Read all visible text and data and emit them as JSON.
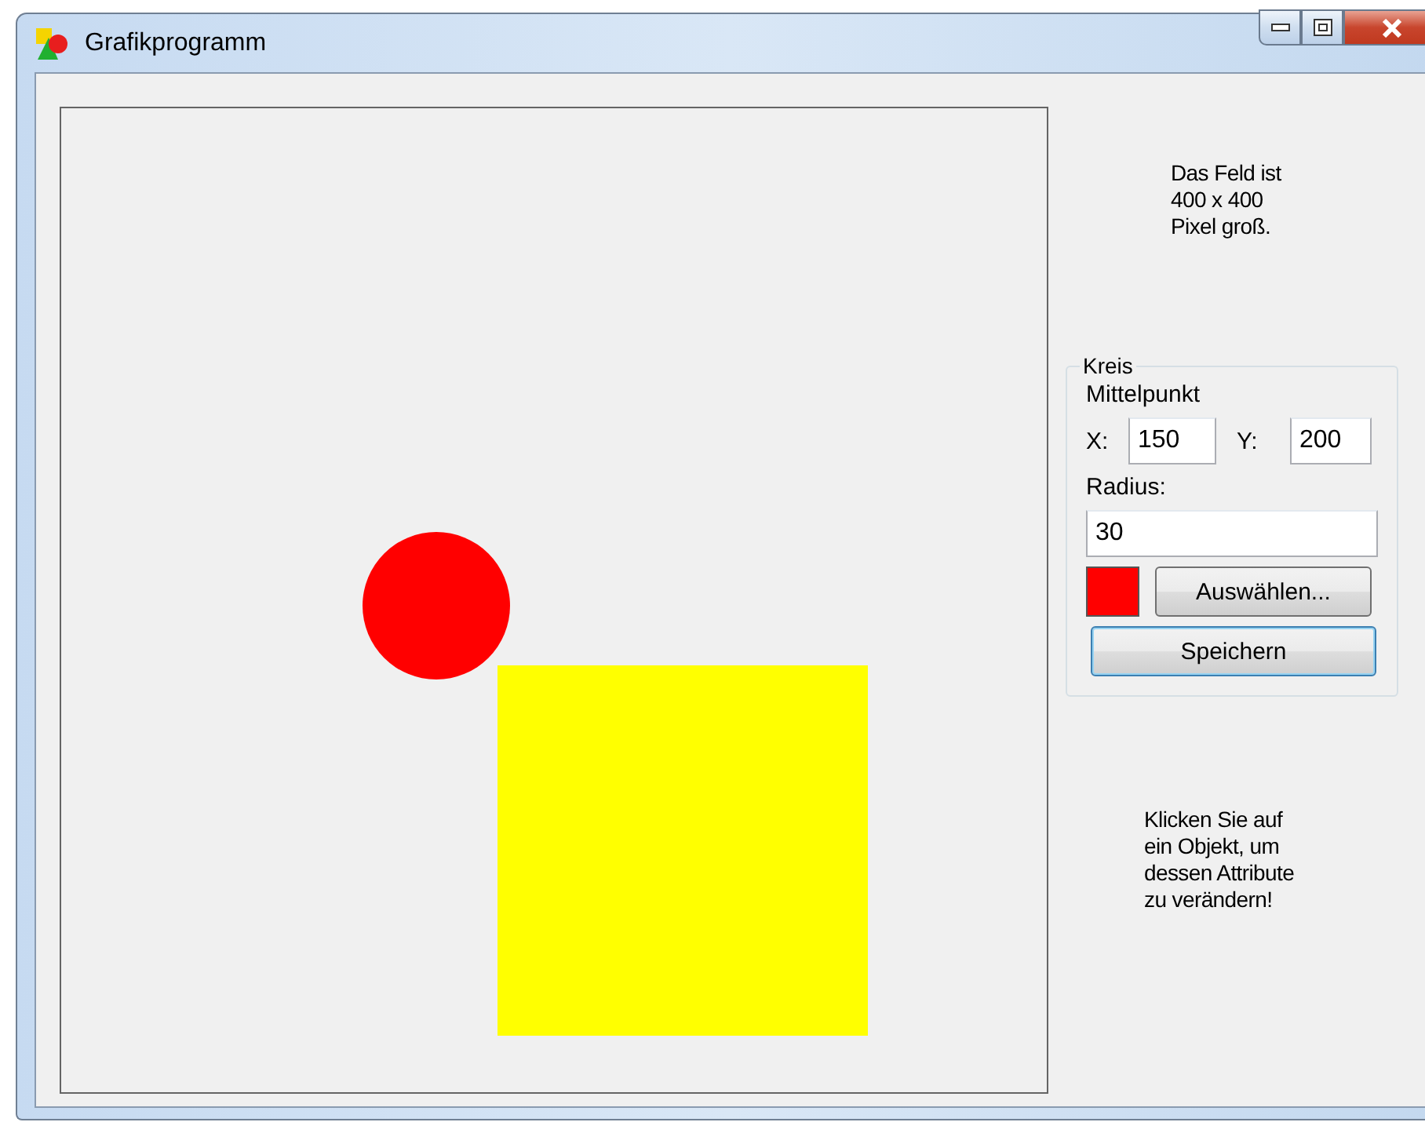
{
  "window": {
    "title": "Grafikprogramm"
  },
  "canvas": {
    "shapes": [
      {
        "kind": "circle",
        "color": "#ff0000"
      },
      {
        "kind": "square",
        "color": "#ffff00"
      }
    ]
  },
  "info": "Das Feld ist\n400 x 400\nPixel groß.",
  "group": {
    "title": "Kreis",
    "center_label": "Mittelpunkt",
    "x_label": "X:",
    "x_value": "150",
    "y_label": "Y:",
    "y_value": "200",
    "radius_label": "Radius:",
    "radius_value": "30",
    "color": "#ff0000",
    "choose_button": "Auswählen...",
    "save_button": "Speichern"
  },
  "hint": "Klicken Sie auf\nein Objekt, um\ndessen Attribute\nzu verändern!"
}
